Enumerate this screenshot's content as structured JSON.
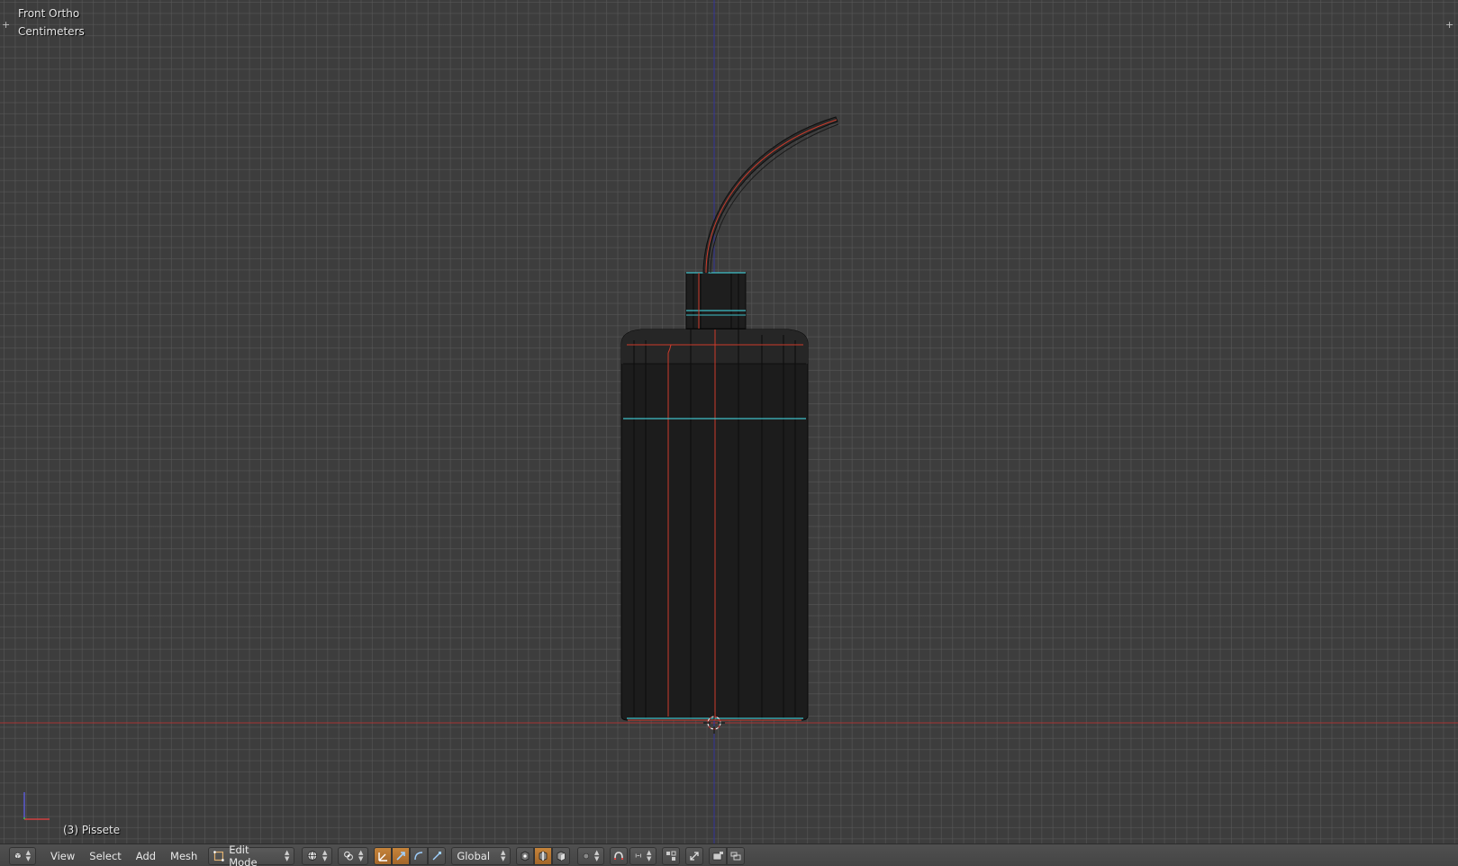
{
  "viewport": {
    "view_name": "Front Ortho",
    "units": "Centimeters",
    "object_info": "(3) Pissete"
  },
  "header": {
    "editor_type_icon": "3d-view-icon",
    "menus": [
      "View",
      "Select",
      "Add",
      "Mesh"
    ],
    "mode": {
      "label": "Edit Mode",
      "icon": "edit-mode-icon"
    },
    "viewport_shading_icon": "globe-shading-icon",
    "pivot_icon": "pivot-point-icon",
    "orientation": "Global",
    "manipulator_icons": [
      "manipulator-toggle-icon",
      "translate-icon",
      "rotate-icon",
      "scale-icon"
    ],
    "select_mode_icons": [
      "vertex-select-icon",
      "edge-select-icon",
      "face-select-icon"
    ],
    "proportional_icon": "proportional-edit-icon",
    "snap_icons": [
      "snap-toggle-icon",
      "snap-element-icon"
    ],
    "extra_icons": [
      "mirror-icon",
      "uv-icon",
      "render-icon",
      "layers-icon"
    ]
  },
  "colors": {
    "grid_bg": "#3d3d3d",
    "x_axis": "#b03a3a",
    "z_axis": "#3b3b9a",
    "edge_seam": "#d23c2c",
    "edge_sharp": "#3fc0c8",
    "mesh_fill": "#1c1c1c",
    "header_active": "#c6843a"
  }
}
